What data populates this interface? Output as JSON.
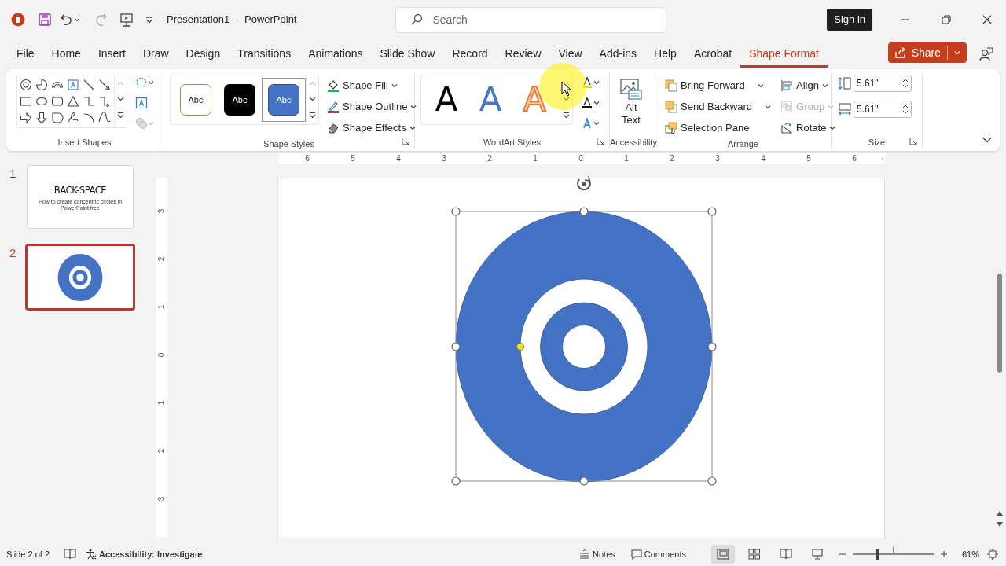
{
  "title_bar": {
    "document_title": "Presentation1  -  PowerPoint",
    "search": {
      "placeholder": "Search"
    },
    "sign_in": "Sign in"
  },
  "ribbon_tabs": [
    {
      "label": "File",
      "selected": false
    },
    {
      "label": "Home",
      "selected": false
    },
    {
      "label": "Insert",
      "selected": false
    },
    {
      "label": "Draw",
      "selected": false
    },
    {
      "label": "Design",
      "selected": false
    },
    {
      "label": "Transitions",
      "selected": false
    },
    {
      "label": "Animations",
      "selected": false
    },
    {
      "label": "Slide Show",
      "selected": false
    },
    {
      "label": "Record",
      "selected": false
    },
    {
      "label": "Review",
      "selected": false
    },
    {
      "label": "View",
      "selected": false
    },
    {
      "label": "Add-ins",
      "selected": false
    },
    {
      "label": "Help",
      "selected": false
    },
    {
      "label": "Acrobat",
      "selected": false
    },
    {
      "label": "Shape Format",
      "selected": true
    }
  ],
  "share_button": "Share",
  "ribbon": {
    "insert_shapes": {
      "label": "Insert Shapes"
    },
    "shape_styles": {
      "label": "Shape Styles",
      "presets": [
        {
          "text": "Abc",
          "kind": "outline",
          "selected": false
        },
        {
          "text": "Abc",
          "kind": "dark",
          "selected": false
        },
        {
          "text": "Abc",
          "kind": "blue",
          "selected": true
        }
      ],
      "commands": [
        "Shape Fill",
        "Shape Outline",
        "Shape Effects"
      ]
    },
    "wordart_styles": {
      "label": "WordArt Styles",
      "samples": [
        {
          "text": "A",
          "kind": "black"
        },
        {
          "text": "A",
          "kind": "blue"
        },
        {
          "text": "A",
          "kind": "orange"
        }
      ]
    },
    "accessibility": {
      "label": "Accessibility",
      "alt_text": "Alt Text"
    },
    "arrange": {
      "label": "Arrange",
      "commands": [
        {
          "label": "Bring Forward",
          "kind": "bring_forward",
          "disabled": false
        },
        {
          "label": "Send Backward",
          "kind": "send_backward",
          "disabled": false
        },
        {
          "label": "Selection Pane",
          "kind": "selection_pane",
          "disabled": false
        },
        {
          "label": "Align",
          "kind": "align",
          "disabled": false
        },
        {
          "label": "Group",
          "kind": "group",
          "disabled": true
        },
        {
          "label": "Rotate",
          "kind": "rotate",
          "disabled": false
        }
      ]
    },
    "size": {
      "label": "Size",
      "height": "5.61\"",
      "width": "5.61\""
    }
  },
  "slides": [
    {
      "number": "1",
      "kind": "title",
      "selected": false,
      "title": "BACK-SPACE",
      "subtitle": "How to create concentric circles in PowerPoint free"
    },
    {
      "number": "2",
      "kind": "rings",
      "selected": true
    }
  ],
  "rulers": {
    "horizontal": [
      "6",
      "5",
      "4",
      "3",
      "2",
      "1",
      "0",
      "1",
      "2",
      "3",
      "4",
      "5",
      "6"
    ],
    "vertical": [
      "3",
      "2",
      "1",
      "0",
      "1",
      "2",
      "3"
    ]
  },
  "status_bar": {
    "slide_indicator": "Slide 2 of 2",
    "accessibility": "Accessibility: Investigate",
    "notes": "Notes",
    "comments": "Comments",
    "views": [
      {
        "kind": "normal",
        "selected": true
      },
      {
        "kind": "sorter",
        "selected": false
      },
      {
        "kind": "reading",
        "selected": false
      },
      {
        "kind": "slideshow",
        "selected": false
      }
    ],
    "zoom": {
      "level": 0.3,
      "reading": "61%"
    }
  }
}
